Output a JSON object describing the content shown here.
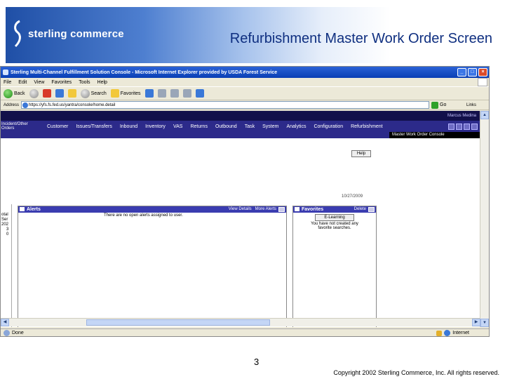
{
  "slide": {
    "logo_text": "sterling commerce",
    "title": "Refurbishment Master Work Order Screen",
    "page_number": "3",
    "copyright": "Copyright 2002 Sterling Commerce, Inc. All rights reserved."
  },
  "browser": {
    "window_title": "Sterling Multi-Channel Fulfillment Solution Console - Microsoft Internet Explorer provided by USDA Forest Service",
    "window_buttons": [
      "_",
      "□",
      "×"
    ],
    "menu": [
      "File",
      "Edit",
      "View",
      "Favorites",
      "Tools",
      "Help"
    ],
    "toolbar": {
      "back": "Back",
      "search": "Search",
      "favorites": "Favorites",
      "links": "Links"
    },
    "address_label": "Address",
    "address_value": "https://yfs.fs.fed.us/yantra/console/home.detail",
    "go": "Go",
    "status_left": "Done",
    "status_right": "Internet"
  },
  "app": {
    "user": "Marcus Medina",
    "nav": [
      "Incident/Other Orders",
      "Customer",
      "Issues/Transfers",
      "Inbound",
      "Inventory",
      "VAS",
      "Returns",
      "Outbound",
      "Task",
      "System",
      "Analytics",
      "Configuration",
      "Refurbishment"
    ],
    "subnav_selected": "Master Work Order Console",
    "help": "Help",
    "date": "10/27/2009",
    "left_strip": [
      "otal",
      "Ser",
      "202",
      "3",
      "0"
    ],
    "alerts": {
      "title": "Alerts",
      "view_details": "View Details",
      "more_alerts": "More Alerts",
      "message": "There are no open alerts assigned to user."
    },
    "favorites": {
      "title": "Favorites",
      "delete": "Delete",
      "button": "E-Learning",
      "message_line1": "You have not created any",
      "message_line2": "favorite searches."
    }
  }
}
